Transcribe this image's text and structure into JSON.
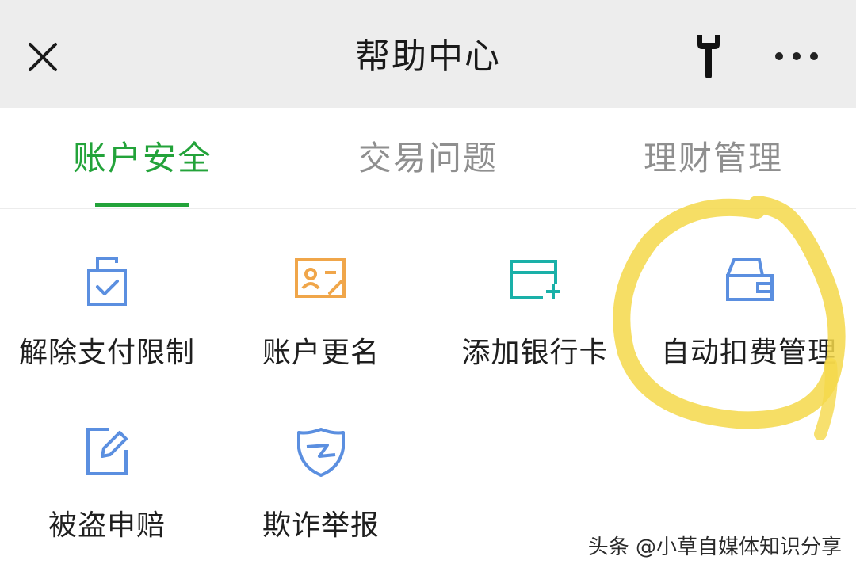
{
  "header": {
    "title": "帮助中心",
    "close_icon": "close-icon",
    "tool_icon": "wrench-icon",
    "more_icon": "more-horizontal-icon"
  },
  "tabs": [
    {
      "label": "账户安全",
      "active": true
    },
    {
      "label": "交易问题",
      "active": false
    },
    {
      "label": "理财管理",
      "active": false
    }
  ],
  "items": [
    {
      "label": "解除支付限制",
      "icon": "lock-check-icon",
      "color": "#5b8fe0"
    },
    {
      "label": "账户更名",
      "icon": "id-card-edit-icon",
      "color": "#f0a64a"
    },
    {
      "label": "添加银行卡",
      "icon": "card-add-icon",
      "color": "#1ab0a8"
    },
    {
      "label": "自动扣费管理",
      "icon": "wallet-icon",
      "color": "#5b8fe0"
    },
    {
      "label": "被盗申赔",
      "icon": "edit-doc-icon",
      "color": "#5b8fe0"
    },
    {
      "label": "欺诈举报",
      "icon": "shield-icon",
      "color": "#5b8fe0"
    }
  ],
  "watermark": "头条 @小草自媒体知识分享",
  "colors": {
    "accent": "#23a33a",
    "highlight": "#f5d84a",
    "header_bg": "#ededed"
  }
}
